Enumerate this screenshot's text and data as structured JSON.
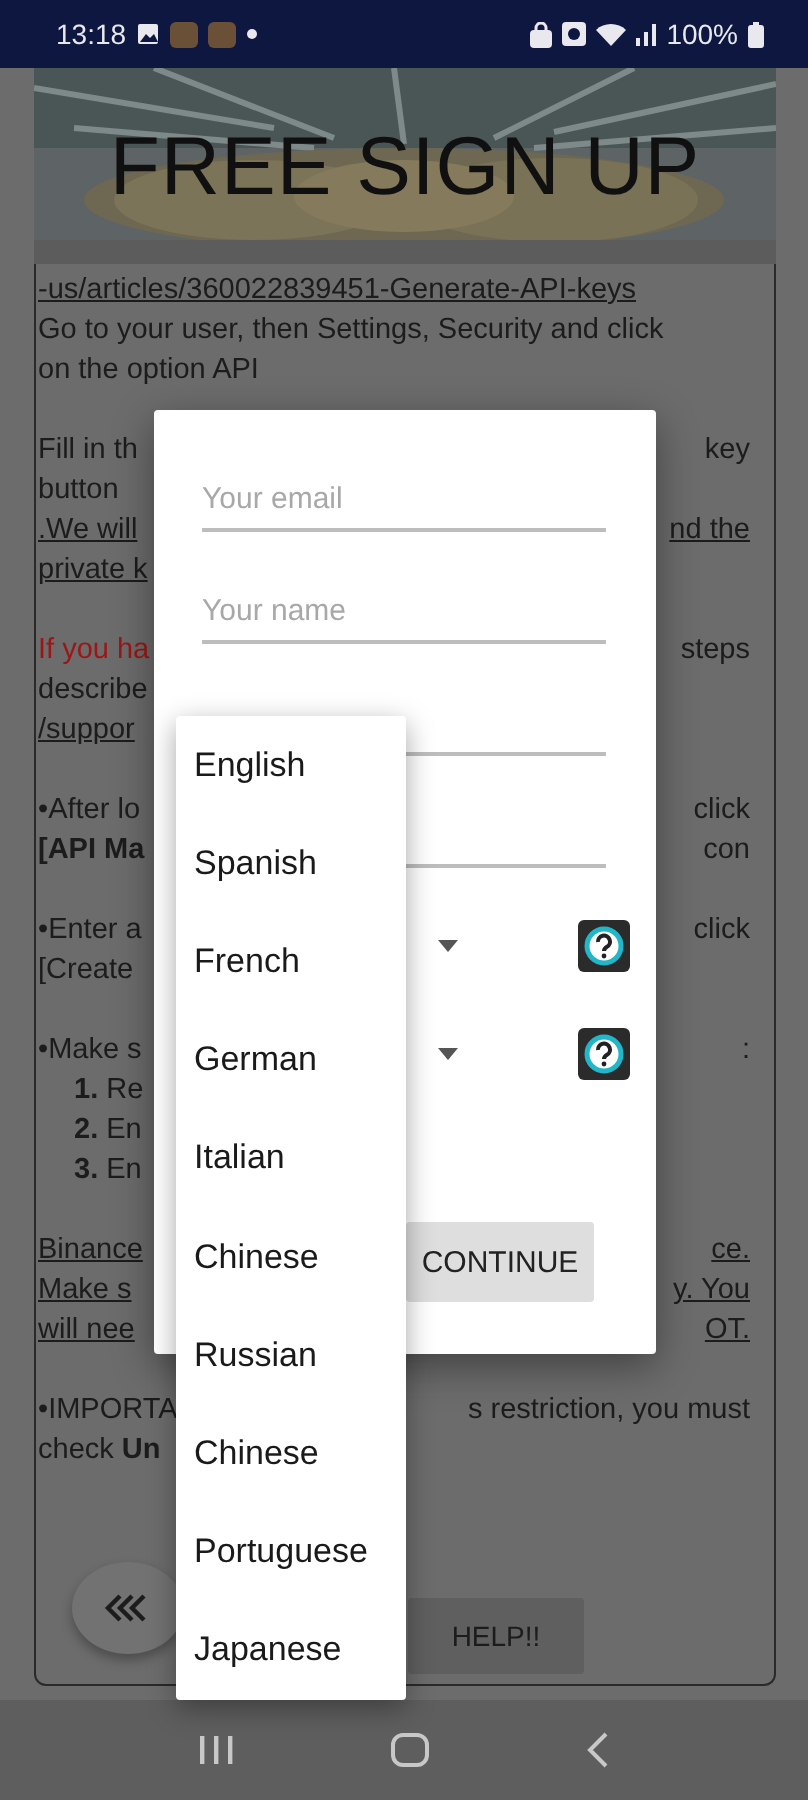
{
  "status_bar": {
    "time": "13:18",
    "battery": "100%"
  },
  "header": {
    "title": "FREE SIGN UP",
    "kind": "picture"
  },
  "paragraphs": [
    {
      "lines": [
        {
          "parts": [
            {
              "text": "-us/articles/360022839451-Generate-API-keys",
              "kind": "link"
            }
          ]
        },
        {
          "parts": [
            {
              "text": " Go to your user, then Settings, Security and click",
              "kind": "plain"
            }
          ]
        },
        {
          "parts": [
            {
              "text": "on the option API",
              "kind": "plain"
            }
          ]
        }
      ]
    },
    {
      "lines": [
        {
          "parts": [
            {
              "text": " Fill in th",
              "kind": "plain"
            },
            {
              "text": "key",
              "kind": "plain"
            }
          ]
        },
        {
          "parts": [
            {
              "text": "button",
              "kind": "plain"
            }
          ]
        },
        {
          "parts": [
            {
              "text": ".We will",
              "kind": "link"
            },
            {
              "text": "nd the",
              "kind": "link"
            }
          ]
        },
        {
          "parts": [
            {
              "text": "private k",
              "kind": "link"
            }
          ]
        }
      ]
    },
    {
      "lines": [
        {
          "parts": [
            {
              "text": "If you ha",
              "kind": "warning"
            },
            {
              "text": "steps",
              "kind": "plain"
            }
          ]
        },
        {
          "parts": [
            {
              "text": "describe",
              "kind": "plain"
            }
          ]
        },
        {
          "parts": [
            {
              "text": "/suppor",
              "kind": "link"
            }
          ]
        }
      ]
    },
    {
      "lines": [
        {
          "parts": [
            {
              "text": "•After lo",
              "kind": "plain"
            },
            {
              "text": "click",
              "kind": "plain"
            }
          ]
        },
        {
          "parts": [
            {
              "text": "[API Ma",
              "kind": "bold"
            },
            {
              "text": "con",
              "kind": "plain"
            }
          ]
        }
      ]
    },
    {
      "lines": [
        {
          "parts": [
            {
              "text": "•Enter a",
              "kind": "plain"
            },
            {
              "text": "click",
              "kind": "plain"
            }
          ]
        },
        {
          "parts": [
            {
              "text": "[Create",
              "kind": "plain"
            }
          ]
        }
      ]
    },
    {
      "lines": [
        {
          "parts": [
            {
              "text": "•Make s",
              "kind": "plain"
            },
            {
              "text": ":",
              "kind": "plain"
            }
          ]
        },
        {
          "parts": [
            {
              "text": "**1.** Re",
              "kind": "item"
            }
          ]
        },
        {
          "parts": [
            {
              "text": "**2.** En",
              "kind": "item"
            }
          ]
        },
        {
          "parts": [
            {
              "text": "**3.** En",
              "kind": "item"
            }
          ]
        }
      ]
    },
    {
      "lines": [
        {
          "parts": [
            {
              "text": "Binance",
              "kind": "link"
            },
            {
              "text": "ce.",
              "kind": "link"
            }
          ]
        },
        {
          "parts": [
            {
              "text": "Make s",
              "kind": "link"
            },
            {
              "text": "y. You",
              "kind": "link"
            }
          ]
        },
        {
          "parts": [
            {
              "text": "will nee",
              "kind": "link"
            },
            {
              "text": "OT.",
              "kind": "link"
            }
          ]
        }
      ]
    },
    {
      "lines": [
        {
          "parts": [
            {
              "text": "•IMPORTA",
              "kind": "plain"
            },
            {
              "text": "s restriction, you must",
              "kind": "plain"
            }
          ]
        },
        {
          "parts": [
            {
              "text": "check **Un**",
              "kind": "plain"
            }
          ]
        }
      ]
    }
  ],
  "help_button": "HELP!!",
  "dialog": {
    "fields": [
      {
        "kind": "text",
        "placeholder": "Your email"
      },
      {
        "kind": "text",
        "placeholder": "Your name"
      },
      {
        "kind": "text"
      },
      {
        "kind": "text"
      },
      {
        "kind": "spinner"
      },
      {
        "kind": "spinner"
      }
    ],
    "continue": "CONTINUE"
  },
  "dropdown": {
    "options": [
      {
        "label": "English"
      },
      {
        "label": "Spanish"
      },
      {
        "label": "French"
      },
      {
        "label": "German"
      },
      {
        "label": "Italian"
      },
      {
        "label": "Chinese"
      },
      {
        "label": "Russian"
      },
      {
        "label": "Chinese"
      },
      {
        "label": "Portuguese"
      },
      {
        "label": "Japanese"
      }
    ]
  }
}
